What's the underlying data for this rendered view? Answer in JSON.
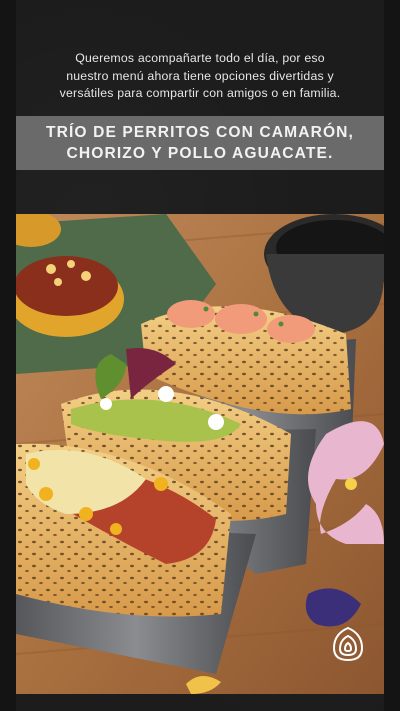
{
  "intro": {
    "line1": "Queremos acompañarte todo el día, por eso",
    "line2": "nuestro menú ahora tiene opciones divertidas y",
    "line3": "versátiles para compartir con amigos o en familia."
  },
  "banner": {
    "line1": "TRÍO DE PERRITOS CON CAMARÓN,",
    "line2": "CHORIZO Y POLLO AGUACATE."
  },
  "photo": {
    "subject": "trio-of-hot-dogs-photo"
  },
  "colors": {
    "background": "#141414",
    "board": "#1c1c1c",
    "banner": "#6a6a6a",
    "text": "#e6e6e6"
  },
  "icons": {
    "brand": "brand-logo-icon"
  }
}
